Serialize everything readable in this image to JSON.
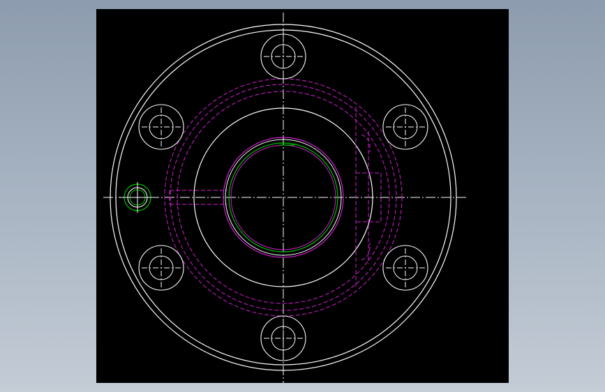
{
  "view": {
    "name": "cad-drawing-viewport",
    "background": "#000000"
  },
  "colors": {
    "outline": "#ffffff",
    "hidden": "#d020d0",
    "centerline": "#ffffff",
    "annotation": "#00c000",
    "window_gradient_top": "#8d9cae",
    "window_gradient_bottom": "#c4ccd6"
  },
  "drawing": {
    "type": "flange-front-view",
    "bolt_holes": 6,
    "features": [
      "outer-flange-circle",
      "bolt-circle-holes",
      "central-bore",
      "hidden-hub-outline",
      "hidden-keyway",
      "side-pin-hole",
      "center-lines"
    ]
  }
}
